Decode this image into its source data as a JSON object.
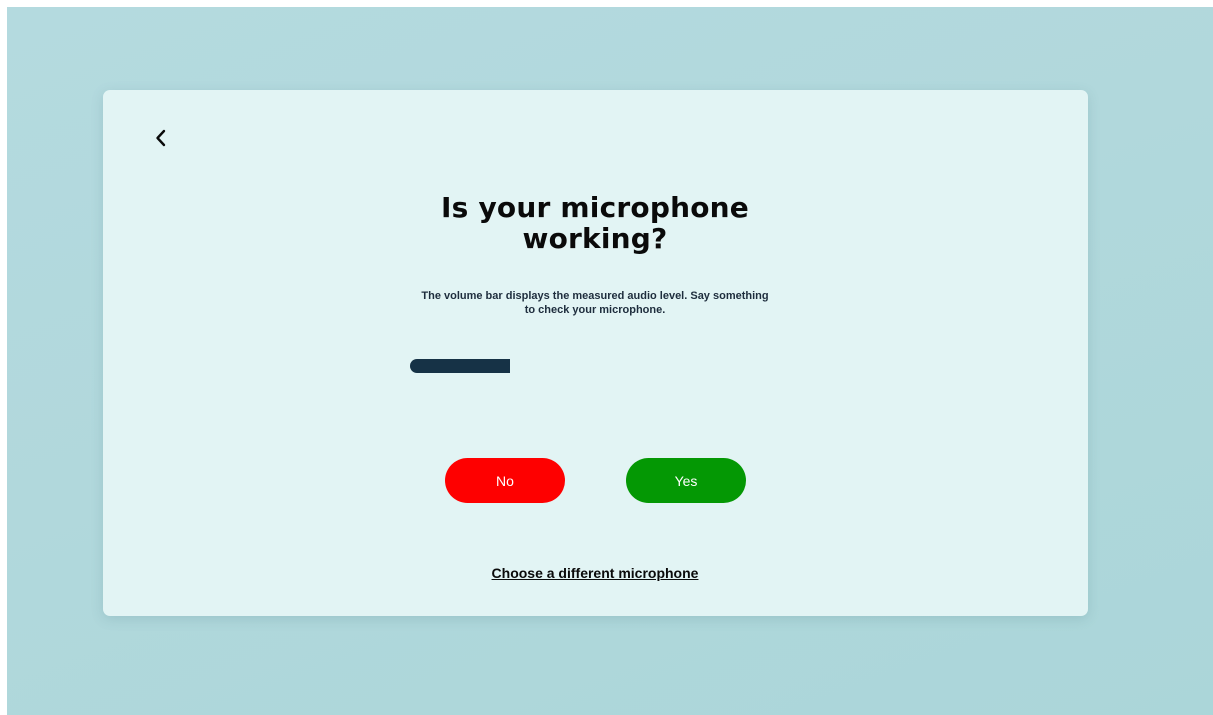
{
  "dialog": {
    "back_icon": "chevron-left-icon",
    "title": "Is your microphone working?",
    "description": "The volume bar displays the measured audio level. Say something to check your microphone.",
    "volume_level_percent": 27
  },
  "buttons": {
    "no_label": "No",
    "yes_label": "Yes"
  },
  "links": {
    "choose_microphone": "Choose a different microphone"
  },
  "colors": {
    "background": "#b1d8dc",
    "card": "#e2f4f4",
    "no_button": "#fe0000",
    "yes_button": "#049804",
    "volume_bar": "#163246"
  }
}
